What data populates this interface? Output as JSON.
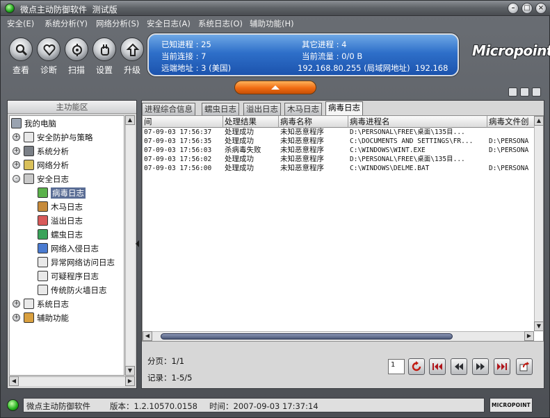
{
  "window": {
    "title": "微点主动防御软件  测试版"
  },
  "menu": [
    {
      "label": "安全(E)"
    },
    {
      "label": "系统分析(Y)"
    },
    {
      "label": "网络分析(S)"
    },
    {
      "label": "安全日志(A)"
    },
    {
      "label": "系统日志(O)"
    },
    {
      "label": "辅助功能(H)"
    }
  ],
  "toolbar": [
    {
      "label": "查看",
      "icon": "magnifier-icon"
    },
    {
      "label": "诊断",
      "icon": "heart-icon"
    },
    {
      "label": "扫描",
      "icon": "scan-icon"
    },
    {
      "label": "设置",
      "icon": "hand-icon"
    },
    {
      "label": "升级",
      "icon": "upgrade-arrow-icon"
    }
  ],
  "info": {
    "known_processes": "已知进程 : 25",
    "other_processes": "其它进程 : 4",
    "current_connections": "当前连接 : 7",
    "current_traffic": "当前流量 : 0/0 B",
    "remote_address": "远端地址 : 3 (美国)",
    "ip_info": "192.168.80.255 (局域网地址)  192.168",
    "panel_color": "#2e6fc9"
  },
  "logo": {
    "text": "Micropoint"
  },
  "left_panel": {
    "header": "主功能区",
    "tree": [
      {
        "label": "我的电脑",
        "level": 0,
        "expander": "",
        "icon": "computer-icon"
      },
      {
        "label": "安全防护与策略",
        "level": 1,
        "expander": "+",
        "icon": "flag-icon"
      },
      {
        "label": "系统分析",
        "level": 1,
        "expander": "+",
        "icon": "monitor-icon"
      },
      {
        "label": "网络分析",
        "level": 1,
        "expander": "+",
        "icon": "network-icon"
      },
      {
        "label": "安全日志",
        "level": 1,
        "expander": "-",
        "icon": "log-book-icon"
      },
      {
        "label": "病毒日志",
        "level": 2,
        "expander": "",
        "icon": "virus-icon",
        "selected": true
      },
      {
        "label": "木马日志",
        "level": 2,
        "expander": "",
        "icon": "trojan-horse-icon"
      },
      {
        "label": "溢出日志",
        "level": 2,
        "expander": "",
        "icon": "overflow-icon"
      },
      {
        "label": "蠕虫日志",
        "level": 2,
        "expander": "",
        "icon": "worm-icon"
      },
      {
        "label": "网络入侵日志",
        "level": 2,
        "expander": "",
        "icon": "sword-icon"
      },
      {
        "label": "异常网络访问日志",
        "level": 2,
        "expander": "",
        "icon": "document-icon"
      },
      {
        "label": "可疑程序日志",
        "level": 2,
        "expander": "",
        "icon": "document-icon"
      },
      {
        "label": "传统防火墙日志",
        "level": 2,
        "expander": "",
        "icon": "document-icon"
      },
      {
        "label": "系统日志",
        "level": 1,
        "expander": "+",
        "icon": "document-icon"
      },
      {
        "label": "辅助功能",
        "level": 1,
        "expander": "+",
        "icon": "tools-icon"
      }
    ]
  },
  "tabs": [
    {
      "label": "进程综合信息",
      "active": false
    },
    {
      "label": "蠕虫日志",
      "active": false
    },
    {
      "label": "溢出日志",
      "active": false
    },
    {
      "label": "木马日志",
      "active": false
    },
    {
      "label": "病毒日志",
      "active": true
    }
  ],
  "table": {
    "columns": [
      "间",
      "处理结果",
      "病毒名称",
      "病毒进程名",
      "病毒文件创"
    ],
    "rows": [
      [
        "07-09-03 17:56:37",
        "处理成功",
        "未知恶意程序",
        "D:\\PERSONAL\\FREE\\桌面\\135目...",
        ""
      ],
      [
        "07-09-03 17:56:35",
        "处理成功",
        "未知恶意程序",
        "C:\\DOCUMENTS AND SETTINGS\\FR...",
        "D:\\PERSONA"
      ],
      [
        "07-09-03 17:56:03",
        "杀病毒失败",
        "未知恶意程序",
        "C:\\WINDOWS\\WINT.EXE",
        "D:\\PERSONA"
      ],
      [
        "07-09-03 17:56:02",
        "处理成功",
        "未知恶意程序",
        "D:\\PERSONAL\\FREE\\桌面\\135目...",
        ""
      ],
      [
        "07-09-03 17:56:00",
        "处理成功",
        "未知恶意程序",
        "C:\\WINDOWS\\DELME.BAT",
        "D:\\PERSONA"
      ]
    ]
  },
  "pager": {
    "page": "分页：1/1",
    "records": "记录：1-5/5",
    "page_input": "1"
  },
  "status": {
    "app_name": "微点主动防御软件",
    "version": "版本：1.2.10570.0158",
    "time": "时间：2007-09-03 17:37:14",
    "logo": "MICROPOINT"
  }
}
